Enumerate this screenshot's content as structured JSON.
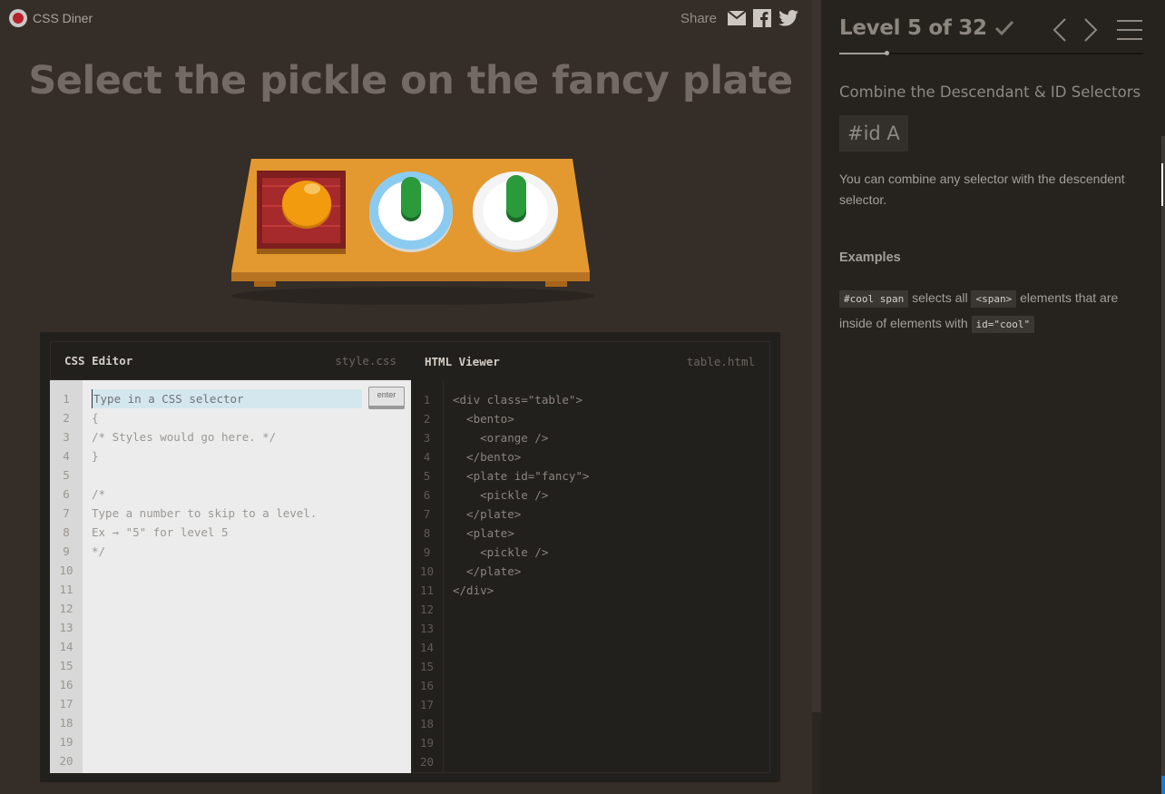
{
  "header": {
    "logo_text": "CSS Diner",
    "share_label": "Share",
    "share_icons": [
      "email-icon",
      "facebook-icon",
      "twitter-icon"
    ]
  },
  "instruction": "Select the pickle on the fancy plate",
  "table_items": [
    "bento-with-orange",
    "fancy-plate-with-pickle",
    "plate-with-pickle"
  ],
  "editor": {
    "css_title": "CSS Editor",
    "css_file": "style.css",
    "html_title": "HTML Viewer",
    "html_file": "table.html",
    "input_placeholder": "Type in a CSS selector",
    "enter_label": "enter",
    "line_numbers": [
      "1",
      "2",
      "3",
      "4",
      "5",
      "6",
      "7",
      "8",
      "9",
      "10",
      "11",
      "12",
      "13",
      "14",
      "15",
      "16",
      "17",
      "18",
      "19",
      "20"
    ],
    "css_lines": [
      "",
      "{",
      "/* Styles would go here. */",
      "}",
      "",
      "/*",
      "Type a number to skip to a level.",
      "Ex → \"5\" for level 5",
      "*/"
    ],
    "html_lines": [
      "<div class=\"table\">",
      "  <bento>",
      "    <orange />",
      "  </bento>",
      "  <plate id=\"fancy\">",
      "    <pickle />",
      "  </plate>",
      "  <plate>",
      "    <pickle />",
      "  </plate>",
      "</div>"
    ]
  },
  "sidebar": {
    "level_text": "Level 5 of 32",
    "current_level": 5,
    "total_levels": 32,
    "selector_name": "Combine the Descendant & ID Selectors",
    "syntax": "#id  A",
    "hint": "You can combine any selector with the descendent selector.",
    "examples_title": "Examples",
    "example": {
      "code1": "#cool span",
      "text1": " selects all ",
      "code2": "<span>",
      "text2": " elements that are inside of elements with ",
      "code3": "id=\"cool\""
    }
  },
  "colors": {
    "background": "#342d28",
    "sidebar": "#26231f",
    "table_wood": "#e0972f",
    "bento": "#a62a2b",
    "orange": "#f29b0e",
    "pickle": "#2a9a3a",
    "fancy_plate_rim": "#8ccbf0"
  }
}
